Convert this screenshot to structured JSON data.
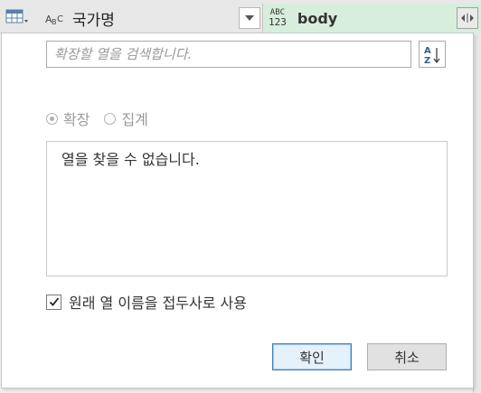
{
  "header": {
    "column1": {
      "type_icon": "ABC",
      "name": "국가명"
    },
    "column2": {
      "type_icon_top": "ABC",
      "type_icon_bottom": "123",
      "name": "body"
    }
  },
  "dialog": {
    "search_placeholder": "확장할 열을 검색합니다.",
    "sort_icon": "sort-az-icon",
    "radio_expand": "확장",
    "radio_aggregate": "집계",
    "selected_mode": "확장",
    "empty_message": "열을 찾을 수 없습니다.",
    "prefix_checkbox_label": "원래 열 이름을 접두사로 사용",
    "prefix_checked": true,
    "ok_label": "확인",
    "cancel_label": "취소"
  },
  "colors": {
    "highlight_column": "#d7eedc",
    "ok_border": "#3c7fb1",
    "disabled_text": "#9a9a9a"
  }
}
